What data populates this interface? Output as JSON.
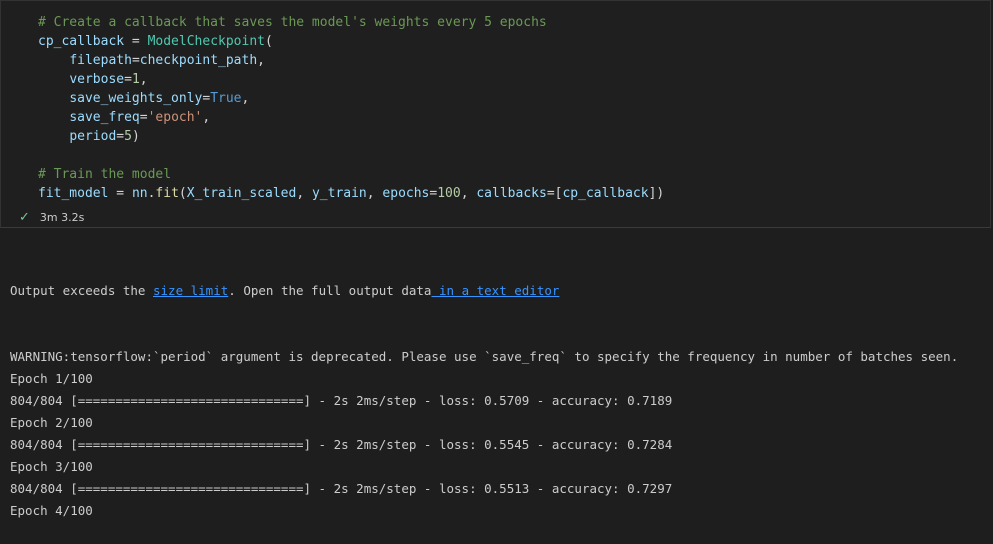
{
  "cell": {
    "code_lines": [
      [
        {
          "t": "# Create a callback that saves the model's weights every 5 epochs",
          "c": "cm"
        }
      ],
      [
        {
          "t": "cp_callback",
          "c": "vr"
        },
        {
          "t": " = ",
          "c": ""
        },
        {
          "t": "ModelCheckpoint",
          "c": "cl"
        },
        {
          "t": "(",
          "c": ""
        }
      ],
      [
        {
          "t": "    ",
          "c": ""
        },
        {
          "t": "filepath",
          "c": "vr"
        },
        {
          "t": "=",
          "c": ""
        },
        {
          "t": "checkpoint_path",
          "c": "vr"
        },
        {
          "t": ",",
          "c": ""
        }
      ],
      [
        {
          "t": "    ",
          "c": ""
        },
        {
          "t": "verbose",
          "c": "vr"
        },
        {
          "t": "=",
          "c": ""
        },
        {
          "t": "1",
          "c": "nm"
        },
        {
          "t": ",",
          "c": ""
        }
      ],
      [
        {
          "t": "    ",
          "c": ""
        },
        {
          "t": "save_weights_only",
          "c": "vr"
        },
        {
          "t": "=",
          "c": ""
        },
        {
          "t": "True",
          "c": "kw"
        },
        {
          "t": ",",
          "c": ""
        }
      ],
      [
        {
          "t": "    ",
          "c": ""
        },
        {
          "t": "save_freq",
          "c": "vr"
        },
        {
          "t": "=",
          "c": ""
        },
        {
          "t": "'epoch'",
          "c": "st"
        },
        {
          "t": ",",
          "c": ""
        }
      ],
      [
        {
          "t": "    ",
          "c": ""
        },
        {
          "t": "period",
          "c": "vr"
        },
        {
          "t": "=",
          "c": ""
        },
        {
          "t": "5",
          "c": "nm"
        },
        {
          "t": ")",
          "c": ""
        }
      ],
      [],
      [
        {
          "t": "# Train the model",
          "c": "cm"
        }
      ],
      [
        {
          "t": "fit_model",
          "c": "vr"
        },
        {
          "t": " = ",
          "c": ""
        },
        {
          "t": "nn",
          "c": "vr"
        },
        {
          "t": ".",
          "c": ""
        },
        {
          "t": "fit",
          "c": "fn"
        },
        {
          "t": "(",
          "c": ""
        },
        {
          "t": "X_train_scaled",
          "c": "vr"
        },
        {
          "t": ", ",
          "c": ""
        },
        {
          "t": "y_train",
          "c": "vr"
        },
        {
          "t": ", ",
          "c": ""
        },
        {
          "t": "epochs",
          "c": "vr"
        },
        {
          "t": "=",
          "c": ""
        },
        {
          "t": "100",
          "c": "nm"
        },
        {
          "t": ", ",
          "c": ""
        },
        {
          "t": "callbacks",
          "c": "vr"
        },
        {
          "t": "=[",
          "c": ""
        },
        {
          "t": "cp_callback",
          "c": "vr"
        },
        {
          "t": "])",
          "c": ""
        }
      ]
    ],
    "exec_time": "3m 3.2s",
    "check_icon": "check-icon"
  },
  "output": {
    "notice_prefix": "Output exceeds the ",
    "notice_link1": "size limit",
    "notice_middle": ". Open the full output data",
    "notice_link2": " in a text editor",
    "lines": [
      "WARNING:tensorflow:`period` argument is deprecated. Please use `save_freq` to specify the frequency in number of batches seen.",
      "Epoch 1/100",
      "804/804 [==============================] - 2s 2ms/step - loss: 0.5709 - accuracy: 0.7189",
      "Epoch 2/100",
      "804/804 [==============================] - 2s 2ms/step - loss: 0.5545 - accuracy: 0.7284",
      "Epoch 3/100",
      "804/804 [==============================] - 2s 2ms/step - loss: 0.5513 - accuracy: 0.7297",
      "Epoch 4/100"
    ]
  },
  "colors": {
    "background": "#1e1e1e",
    "comment": "#6a9955",
    "variable": "#9cdcfe",
    "link": "#3794ff",
    "success": "#73c991"
  }
}
